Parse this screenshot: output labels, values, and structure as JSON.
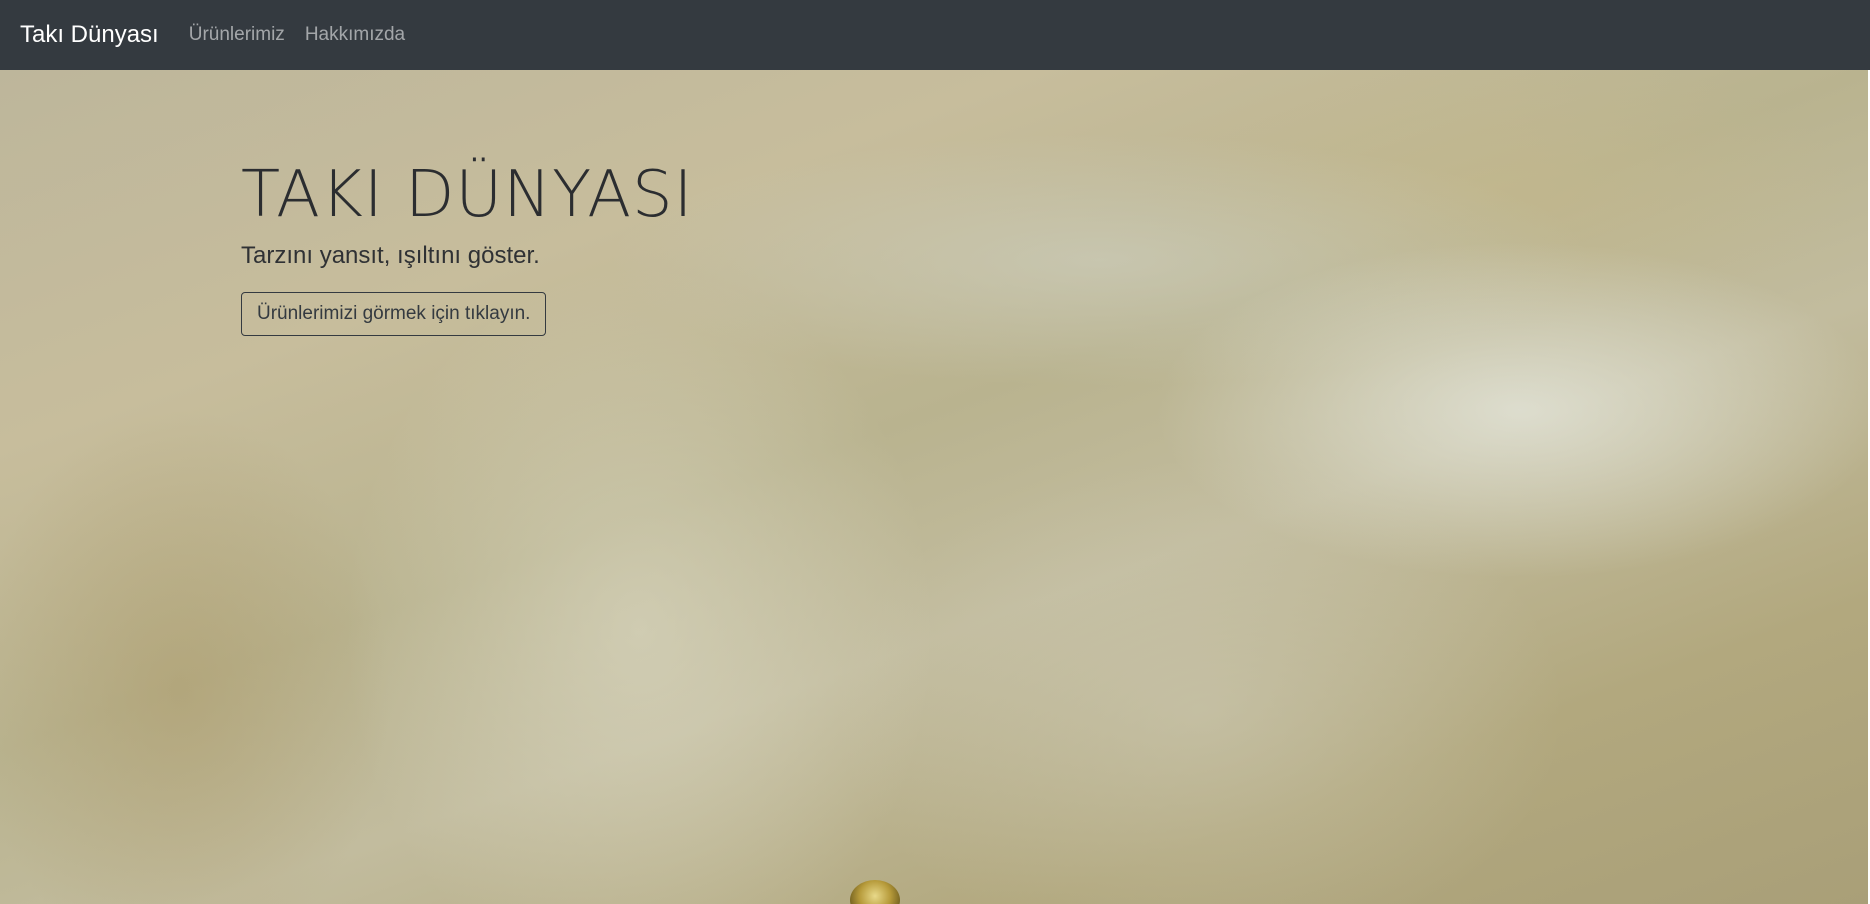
{
  "navbar": {
    "brand": "Takı Dünyası",
    "links": [
      {
        "label": "Ürünlerimiz"
      },
      {
        "label": "Hakkımızda"
      }
    ]
  },
  "hero": {
    "title": "TAKI DÜNYASI",
    "subtitle": "Tarzını yansıt, ışıltını göster.",
    "button_label": "Ürünlerimizi görmek için tıklayın."
  },
  "colors": {
    "navbar_bg": "#343a40",
    "brand_text": "#ffffff",
    "nav_link_text": "#9a9da0",
    "hero_text": "#2b2d30"
  }
}
